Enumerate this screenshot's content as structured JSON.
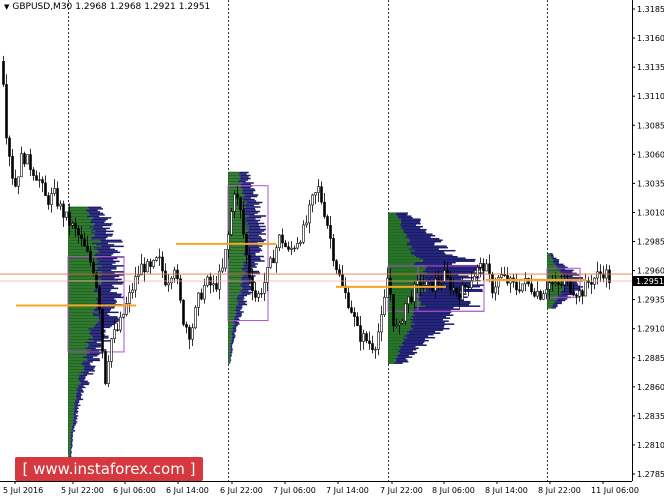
{
  "header": {
    "symbol": "GBPUSD,M30",
    "open": "1.2968",
    "high": "1.2968",
    "low": "1.2921",
    "close": "1.2951"
  },
  "watermark": {
    "text": "[ www.instaforex.com ]"
  },
  "colors": {
    "bull_candle": "#ffffff",
    "bear_candle": "#000000",
    "profile_green": "#1e6b1e",
    "profile_navy": "#1a1a6e",
    "box_purple": "#b04fd0",
    "poc_orange": "#f4a623",
    "current_price_line": "#e8743b",
    "price_tag_bg": "#000000",
    "watermark_bg": "#d5383e"
  },
  "chart_data": {
    "type": "candlestick",
    "symbol": "GBPUSD",
    "timeframe": "M30",
    "y_ticks": [
      "1.3185",
      "1.3160",
      "1.3135",
      "1.3110",
      "1.3085",
      "1.3060",
      "1.3035",
      "1.3010",
      "1.2985",
      "1.2960",
      "1.2935",
      "1.2910",
      "1.2885",
      "1.2860",
      "1.2835",
      "1.2810",
      "1.2785"
    ],
    "x_ticks": [
      "5 Jul 2016",
      "5 Jul 22:00",
      "6 Jul 06:00",
      "6 Jul 14:00",
      "6 Jul 22:00",
      "7 Jul 06:00",
      "7 Jul 14:00",
      "7 Jul 22:00",
      "8 Jul 06:00",
      "8 Jul 14:00",
      "8 Jul 22:00",
      "11 Jul 06:00"
    ],
    "ylim": [
      1.2776,
      1.3193
    ],
    "current_price": "1.2951",
    "current_price_value": 1.2951,
    "reference_line_value": 1.2957,
    "session_separators": [
      "5 Jul 22:00",
      "6 Jul 22:00",
      "7 Jul 22:00",
      "8 Jul 22:00"
    ],
    "close_path": [
      [
        0,
        1.317
      ],
      [
        6,
        1.308
      ],
      [
        14,
        1.303
      ],
      [
        22,
        1.306
      ],
      [
        30,
        1.305
      ],
      [
        38,
        1.304
      ],
      [
        46,
        1.302
      ],
      [
        54,
        1.3025
      ],
      [
        62,
        1.301
      ],
      [
        70,
        1.3
      ],
      [
        78,
        1.299
      ],
      [
        86,
        1.2975
      ],
      [
        94,
        1.296
      ],
      [
        100,
        1.2925
      ],
      [
        104,
        1.286
      ],
      [
        110,
        1.29
      ],
      [
        118,
        1.291
      ],
      [
        126,
        1.293
      ],
      [
        134,
        1.295
      ],
      [
        142,
        1.2965
      ],
      [
        150,
        1.296
      ],
      [
        158,
        1.297
      ],
      [
        166,
        1.295
      ],
      [
        174,
        1.2965
      ],
      [
        182,
        1.292
      ],
      [
        190,
        1.2905
      ],
      [
        198,
        1.2935
      ],
      [
        206,
        1.295
      ],
      [
        214,
        1.2945
      ],
      [
        222,
        1.296
      ],
      [
        228,
        1.299
      ],
      [
        234,
        1.303
      ],
      [
        240,
        1.301
      ],
      [
        248,
        1.296
      ],
      [
        256,
        1.2935
      ],
      [
        264,
        1.295
      ],
      [
        272,
        1.297
      ],
      [
        280,
        1.299
      ],
      [
        288,
        1.2975
      ],
      [
        296,
        1.2985
      ],
      [
        304,
        1.2995
      ],
      [
        312,
        1.302
      ],
      [
        318,
        1.303
      ],
      [
        326,
        1.3005
      ],
      [
        334,
        1.297
      ],
      [
        342,
        1.2945
      ],
      [
        350,
        1.293
      ],
      [
        358,
        1.2905
      ],
      [
        366,
        1.29
      ],
      [
        374,
        1.2895
      ],
      [
        382,
        1.292
      ],
      [
        388,
        1.296
      ],
      [
        392,
        1.292
      ],
      [
        398,
        1.2905
      ],
      [
        404,
        1.293
      ],
      [
        412,
        1.294
      ],
      [
        420,
        1.295
      ],
      [
        428,
        1.2945
      ],
      [
        436,
        1.295
      ],
      [
        444,
        1.2955
      ],
      [
        452,
        1.2945
      ],
      [
        460,
        1.294
      ],
      [
        468,
        1.295
      ],
      [
        476,
        1.296
      ],
      [
        484,
        1.2965
      ],
      [
        492,
        1.2945
      ],
      [
        500,
        1.2955
      ],
      [
        508,
        1.295
      ],
      [
        516,
        1.2945
      ],
      [
        524,
        1.295
      ],
      [
        532,
        1.2945
      ],
      [
        540,
        1.294
      ],
      [
        548,
        1.295
      ],
      [
        556,
        1.2945
      ],
      [
        564,
        1.295
      ],
      [
        572,
        1.2945
      ],
      [
        580,
        1.294
      ],
      [
        588,
        1.295
      ],
      [
        596,
        1.2955
      ],
      [
        604,
        1.296
      ],
      [
        610,
        1.2951
      ]
    ],
    "volume_profiles": [
      {
        "session": "5 Jul",
        "base_bar": 68,
        "width": 56,
        "low": 1.279,
        "high": 1.3015,
        "poc": 1.2955,
        "green_frac": 0.6
      },
      {
        "session": "6 Jul",
        "base_bar": 228,
        "width": 38,
        "low": 1.288,
        "high": 1.3045,
        "poc": 1.299,
        "green_frac": 0.55
      },
      {
        "session": "7 Jul",
        "base_bar": 388,
        "width": 96,
        "low": 1.288,
        "high": 1.301,
        "poc": 1.2948,
        "green_frac": 0.4
      },
      {
        "session": "8 Jul",
        "base_bar": 547,
        "width": 36,
        "low": 1.2928,
        "high": 1.2975,
        "poc": 1.295,
        "green_frac": 0.5
      }
    ],
    "value_area_boxes": [
      {
        "session": "5 Jul",
        "x0": 68,
        "x1": 124,
        "low": 1.289,
        "high": 1.2972
      },
      {
        "session": "6 Jul",
        "x0": 228,
        "x1": 268,
        "low": 1.2917,
        "high": 1.3033
      },
      {
        "session": "7 Jul",
        "x0": 388,
        "x1": 484,
        "low": 1.2925,
        "high": 1.2964
      },
      {
        "session": "7 Jul b",
        "x0": 418,
        "x1": 484,
        "low": 1.2925,
        "high": 1.2964
      },
      {
        "session": "8 Jul",
        "x0": 547,
        "x1": 580,
        "low": 1.2937,
        "high": 1.2962
      }
    ],
    "poc_lines": [
      {
        "x0": 16,
        "x1": 136,
        "value": 1.293
      },
      {
        "x0": 176,
        "x1": 276,
        "value": 1.2983
      },
      {
        "x0": 336,
        "x1": 446,
        "value": 1.2946
      },
      {
        "x0": 486,
        "x1": 586,
        "value": 1.2952
      }
    ]
  }
}
